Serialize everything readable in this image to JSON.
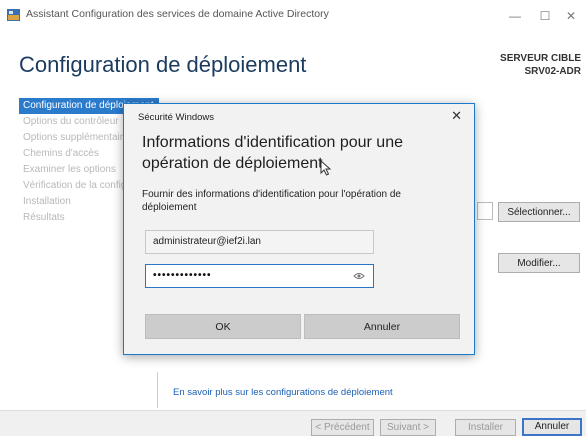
{
  "window": {
    "title": "Assistant Configuration des services de domaine Active Directory",
    "minimize_glyph": "—",
    "maximize_glyph": "☐",
    "close_glyph": "✕"
  },
  "page": {
    "title": "Configuration de déploiement",
    "target_label": "SERVEUR CIBLE",
    "target_value": "SRV02-ADR"
  },
  "nav": {
    "items": [
      "Configuration de déploiement",
      "Options du contrôleur",
      "Options supplémentaires",
      "Chemins d'accès",
      "Examiner les options",
      "Vérification de la configuration",
      "Installation",
      "Résultats"
    ]
  },
  "main": {
    "select_button": "Sélectionner...",
    "modify_button": "Modifier...",
    "learn_more_link": "En savoir plus sur les configurations de déploiement"
  },
  "footer": {
    "prev": "< Précédent",
    "next": "Suivant >",
    "install": "Installer",
    "cancel": "Annuler"
  },
  "dialog": {
    "header": "Sécurité Windows",
    "close_glyph": "✕",
    "title": "Informations d'identification pour une opération de déploiement",
    "description": "Fournir des informations d'identification pour l'opération de déploiement",
    "username_value": "administrateur@ief2i.lan",
    "password_mask": "•••••••••••••",
    "ok_button": "OK",
    "cancel_button": "Annuler"
  },
  "colors": {
    "accent": "#2b7bcd",
    "title": "#1b3b5f",
    "dialog_border": "#1979ca",
    "link": "#1a5fb4"
  },
  "icons": [
    "app-icon",
    "pointer-cursor-icon",
    "eye-reveal-icon"
  ]
}
